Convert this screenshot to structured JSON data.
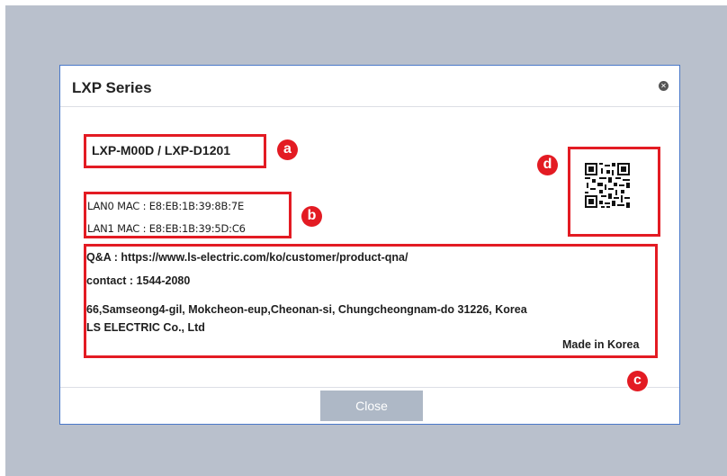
{
  "dialog": {
    "title": "LXP Series",
    "model": "LXP-M00D / LXP-D1201",
    "lan0_mac": "LAN0 MAC : E8:EB:1B:39:8B:7E",
    "lan1_mac": "LAN1 MAC : E8:EB:1B:39:5D:C6",
    "qna": "Q&A : https://www.ls-electric.com/ko/customer/product-qna/",
    "contact": "contact : 1544-2080",
    "address": "66,Samseong4-gil, Mokcheon-eup,Cheonan-si, Chungcheongnam-do 31226, Korea",
    "company": "LS ELECTRIC Co., Ltd",
    "made_in": "Made in Korea",
    "close_button": "Close"
  },
  "callouts": {
    "a": "a",
    "b": "b",
    "c": "c",
    "d": "d"
  },
  "colors": {
    "annotation_red": "#e31b23",
    "dialog_border": "#4a78c9",
    "backdrop": "#b9c0cc",
    "close_button_bg": "#aeb8c6"
  }
}
